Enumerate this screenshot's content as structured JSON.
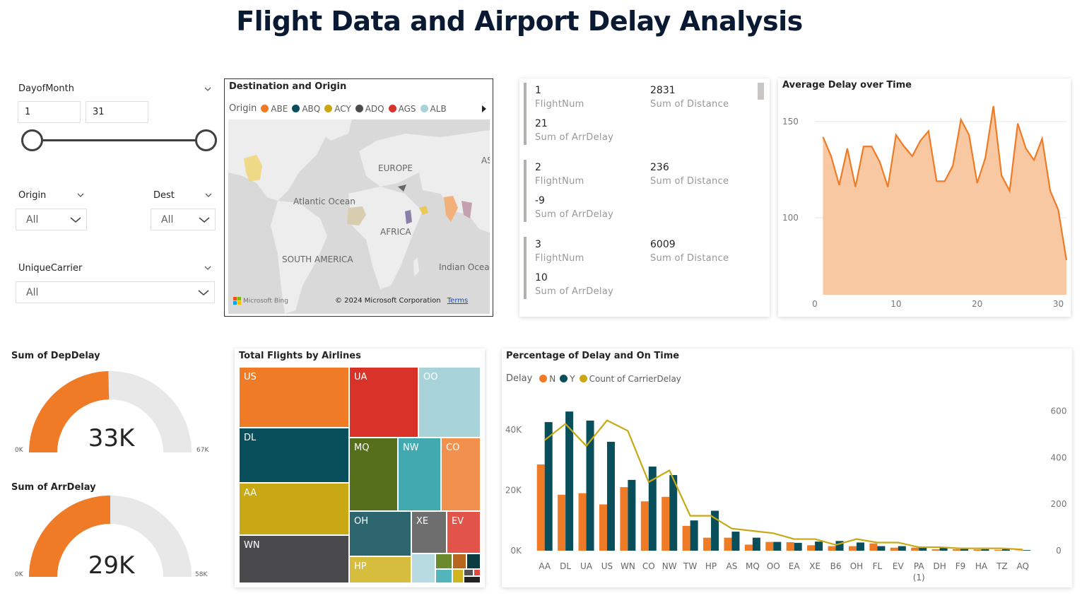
{
  "title": "Flight Data and Airport Delay Analysis",
  "filters": {
    "day_of_month": {
      "label": "DayofMonth",
      "min": "1",
      "max": "31",
      "range_start": 1,
      "range_end": 31
    },
    "origin": {
      "label": "Origin",
      "value": "All"
    },
    "dest": {
      "label": "Dest",
      "value": "All"
    },
    "carrier": {
      "label": "UniqueCarrier",
      "value": "All"
    }
  },
  "map": {
    "title": "Destination and Origin",
    "legend_title": "Origin",
    "legend": [
      {
        "name": "ABE",
        "color": "#f07b26"
      },
      {
        "name": "ABQ",
        "color": "#094f5b"
      },
      {
        "name": "ACY",
        "color": "#c8a914"
      },
      {
        "name": "ADQ",
        "color": "#4c4c4c"
      },
      {
        "name": "AGS",
        "color": "#d93228"
      },
      {
        "name": "ALB",
        "color": "#a8d3d8"
      }
    ],
    "labels": {
      "europe": "EUROPE",
      "atlantic": "Atlantic Ocean",
      "africa": "AFRICA",
      "south_america": "SOUTH AMERICA",
      "indian": "Indian Ocea",
      "asia": "AS"
    },
    "bing": "Microsoft Bing",
    "copyright": "© 2024 Microsoft Corporation",
    "terms": "Terms"
  },
  "cards": [
    {
      "flightnum": "1",
      "flightnum_label": "FlightNum",
      "distance": "2831",
      "distance_label": "Sum of Distance",
      "arrdelay": "21",
      "arrdelay_label": "Sum of ArrDelay"
    },
    {
      "flightnum": "2",
      "flightnum_label": "FlightNum",
      "distance": "236",
      "distance_label": "Sum of Distance",
      "arrdelay": "-9",
      "arrdelay_label": "Sum of ArrDelay"
    },
    {
      "flightnum": "3",
      "flightnum_label": "FlightNum",
      "distance": "6009",
      "distance_label": "Sum of Distance",
      "arrdelay": "10",
      "arrdelay_label": "Sum of ArrDelay"
    }
  ],
  "gauges": [
    {
      "title": "Sum of DepDelay",
      "value_label": "33K",
      "min_label": "0K",
      "max_label": "67K",
      "value": 33,
      "max": 67,
      "color": "#f07b26"
    },
    {
      "title": "Sum of ArrDelay",
      "value_label": "29K",
      "min_label": "0K",
      "max_label": "58K",
      "value": 29,
      "max": 58,
      "color": "#f07b26"
    }
  ],
  "treemap": {
    "title": "Total Flights by Airlines",
    "items": [
      {
        "name": "US",
        "color": "#f07b26"
      },
      {
        "name": "DL",
        "color": "#094f5b"
      },
      {
        "name": "AA",
        "color": "#c8a914"
      },
      {
        "name": "WN",
        "color": "#4a4a4c"
      },
      {
        "name": "UA",
        "color": "#d93228"
      },
      {
        "name": "OO",
        "color": "#a8d3d8"
      },
      {
        "name": "MQ",
        "color": "#566f1a"
      },
      {
        "name": "NW",
        "color": "#43a9b1"
      },
      {
        "name": "CO",
        "color": "#f2914d"
      },
      {
        "name": "OH",
        "color": "#2e6670"
      },
      {
        "name": "XE",
        "color": "#6e6e6e"
      },
      {
        "name": "EV",
        "color": "#e2534a"
      },
      {
        "name": "HP",
        "color": "#d6bd3e"
      }
    ]
  },
  "chart_data": [
    {
      "type": "area",
      "title": "Average Delay over Time",
      "x": [
        1,
        2,
        3,
        4,
        5,
        6,
        7,
        8,
        9,
        10,
        11,
        12,
        13,
        14,
        15,
        16,
        17,
        18,
        19,
        20,
        21,
        22,
        23,
        24,
        25,
        26,
        27,
        28,
        29,
        30,
        31
      ],
      "values": [
        142,
        132,
        117,
        136,
        116,
        137,
        137,
        129,
        116,
        143,
        137,
        132,
        140,
        145,
        119,
        119,
        127,
        151,
        143,
        118,
        131,
        158,
        122,
        114,
        149,
        136,
        130,
        141,
        114,
        104,
        78
      ],
      "xticks": [
        0,
        10,
        20,
        30
      ],
      "yticks": [
        100,
        150
      ],
      "xlim": [
        0,
        31
      ],
      "ylim": [
        60,
        165
      ],
      "color": "#f07b26"
    },
    {
      "type": "bar",
      "title": "Percentage of Delay and On Time",
      "legend_title": "Delay",
      "categories": [
        "AA",
        "DL",
        "UA",
        "US",
        "WN",
        "CO",
        "NW",
        "TW",
        "HP",
        "AS",
        "MQ",
        "OO",
        "EA",
        "XE",
        "B6",
        "OH",
        "FL",
        "EV",
        "PA\n(1)",
        "DH",
        "F9",
        "HA",
        "TZ",
        "AQ"
      ],
      "series": [
        {
          "name": "N",
          "color": "#f07b26",
          "axis": "left",
          "values": [
            28500,
            18500,
            19000,
            15300,
            21000,
            16300,
            17800,
            8200,
            4300,
            4300,
            2000,
            2900,
            2800,
            1800,
            1500,
            1500,
            2400,
            1000,
            1000,
            500,
            500,
            400,
            300,
            100
          ]
        },
        {
          "name": "Y",
          "color": "#094f5b",
          "axis": "left",
          "values": [
            42500,
            46000,
            43000,
            36000,
            23400,
            27800,
            25000,
            10000,
            13200,
            6300,
            4300,
            2900,
            2600,
            3000,
            3200,
            2700,
            1500,
            1500,
            1400,
            1200,
            700,
            500,
            500,
            200
          ]
        },
        {
          "name": "Count of CarrierDelay",
          "color": "#c8a914",
          "type": "line",
          "axis": "right",
          "values": [
            475,
            545,
            450,
            560,
            515,
            295,
            345,
            150,
            150,
            95,
            85,
            75,
            50,
            50,
            25,
            50,
            35,
            35,
            15,
            15,
            10,
            10,
            10,
            5
          ]
        }
      ],
      "yticks_left": [
        "0K",
        "20K",
        "40K"
      ],
      "yticks_right": [
        "0",
        "200",
        "400",
        "600"
      ],
      "ylim_left": [
        0,
        50000
      ],
      "ylim_right": [
        0,
        650
      ]
    }
  ]
}
